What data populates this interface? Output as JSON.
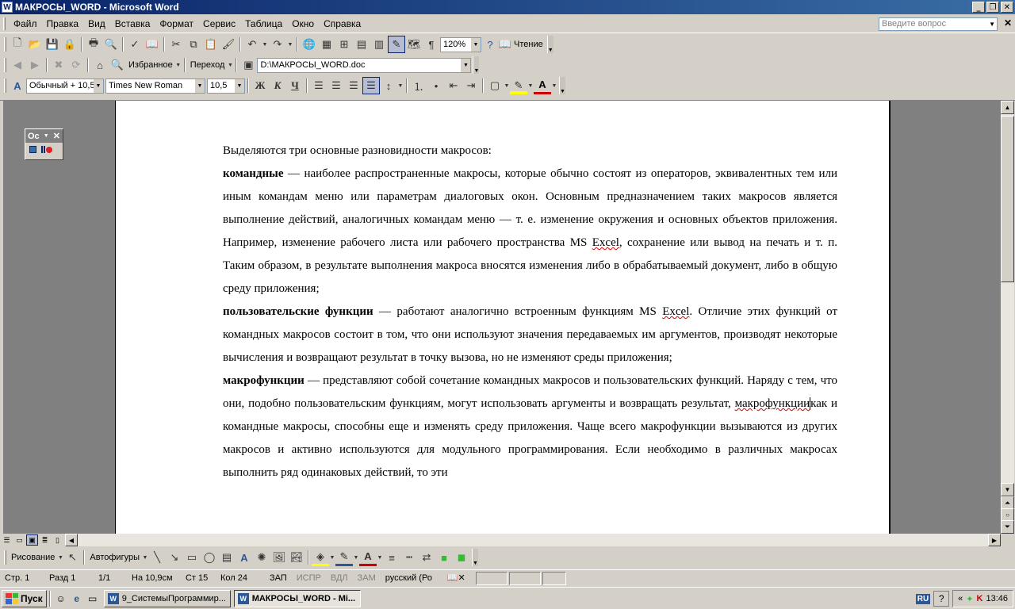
{
  "window": {
    "title": "МАКРОСЫ_WORD - Microsoft Word"
  },
  "menu": {
    "items": [
      "Файл",
      "Правка",
      "Вид",
      "Вставка",
      "Формат",
      "Сервис",
      "Таблица",
      "Окно",
      "Справка"
    ],
    "ask_placeholder": "Введите вопрос"
  },
  "toolbar_standard": {
    "zoom": "120%",
    "reading_label": "Чтение"
  },
  "toolbar_web": {
    "favorites_label": "Избранное",
    "go_label": "Переход",
    "address": "D:\\МАКРОСЫ_WORD.doc"
  },
  "toolbar_format": {
    "style": "Обычный + 10,5",
    "font": "Times New Roman",
    "size": "10,5",
    "bold": "Ж",
    "italic": "К",
    "underline": "Ч"
  },
  "macro_toolbar": {
    "title": "Ос"
  },
  "document": {
    "p1": "Выделяются три основные разновидности макросов:",
    "p2_bold": "командные",
    "p2_a": " — наиболее распространенные макросы, которые обычно состоят из операторов, эквивалентных тем или иным командам меню или параметрам диалоговых окон. Основным предназначением таких макросов является выполнение действий, аналогичных командам меню — т. е. изменение окружения и основных объектов приложения. Например, изменение рабочего листа или рабочего пространства MS ",
    "p2_excel": "Excel",
    "p2_b": ", сохранение или вывод на печать и т. п. Таким образом, в результате выполнения макроса вносятся изменения либо в обрабатываемый документ, либо в общую среду приложения;",
    "p3_bold": "пользовательские функции",
    "p3_a": " — работают аналогично встроенным функциям MS ",
    "p3_excel": "Excel",
    "p3_b": ". Отличие этих функций от командных макросов состоит в том, что они используют значения передаваемых им аргументов, производят некоторые вычисления и возвращают результат в точку вызова, но не изменяют среды приложения;",
    "p4_bold": "макрофункции",
    "p4_a": " — представляют собой сочетание командных макросов и пользовательских функций. Наряду с тем, что они, подобно пользовательским функциям, могут использовать аргументы и возвращать результат, ",
    "p4_word": "макрофункции",
    "p4_mid": "как",
    "p4_b": " и командные макросы, способны еще и изменять среду приложения. Чаще всего макрофункции вызываются из других макросов и активно используются для модульного программирования. Если необходимо в различных макросах выполнить ряд одинаковых действий, то эти"
  },
  "drawing_toolbar": {
    "draw_label": "Рисование",
    "autoshapes_label": "Автофигуры"
  },
  "status": {
    "page": "Стр. 1",
    "section": "Разд 1",
    "pages": "1/1",
    "position": "На 10,9см",
    "line": "Ст 15",
    "column": "Кол 24",
    "rec": "ЗАП",
    "trk": "ИСПР",
    "ext": "ВДЛ",
    "ovr": "ЗАМ",
    "language": "русский (Ро"
  },
  "taskbar": {
    "start": "Пуск",
    "tasks": [
      "9_СистемыПрограммир...",
      "МАКРОСЫ_WORD - Mi..."
    ],
    "lang": "RU",
    "clock": "13:46"
  }
}
